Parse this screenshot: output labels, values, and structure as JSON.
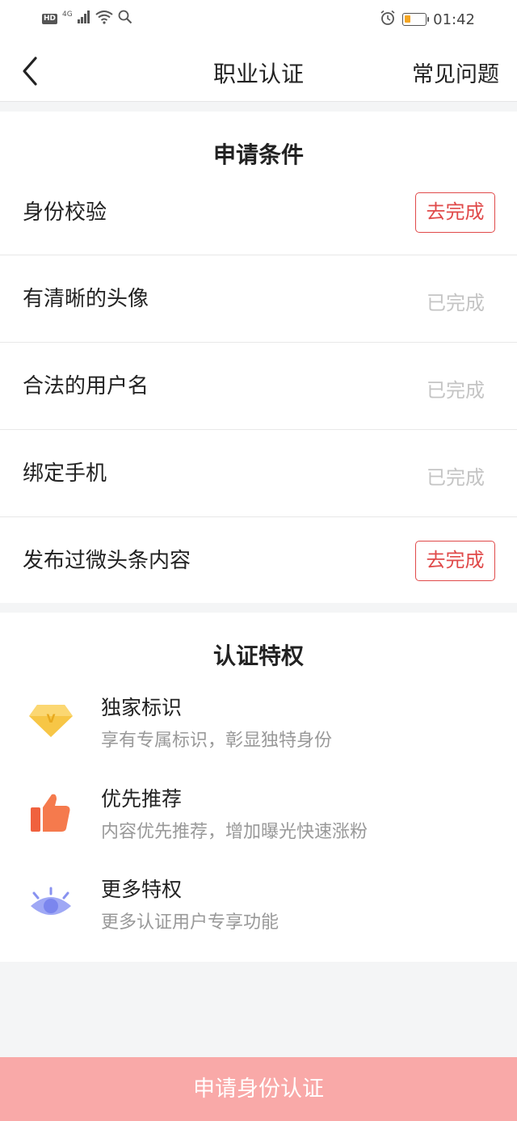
{
  "status_bar": {
    "hd": "HD",
    "network": "4G",
    "time": "01:42",
    "icons": [
      "signal-icon",
      "wifi-icon",
      "search-icon",
      "alarm-icon",
      "battery-icon"
    ]
  },
  "header": {
    "title": "职业认证",
    "faq_label": "常见问题",
    "back_icon": "chevron-left-icon"
  },
  "conditions": {
    "title": "申请条件",
    "items": [
      {
        "label": "身份校验",
        "status": "去完成",
        "done": false
      },
      {
        "label": "有清晰的头像",
        "status": "已完成",
        "done": true
      },
      {
        "label": "合法的用户名",
        "status": "已完成",
        "done": true
      },
      {
        "label": "绑定手机",
        "status": "已完成",
        "done": true
      },
      {
        "label": "发布过微头条内容",
        "status": "去完成",
        "done": false
      }
    ]
  },
  "privileges": {
    "title": "认证特权",
    "items": [
      {
        "name": "独家标识",
        "desc": "享有专属标识，彰显独特身份",
        "icon": "diamond-icon"
      },
      {
        "name": "优先推荐",
        "desc": "内容优先推荐，增加曝光快速涨粉",
        "icon": "thumbs-up-icon"
      },
      {
        "name": "更多特权",
        "desc": "更多认证用户专享功能",
        "icon": "eye-icon"
      }
    ]
  },
  "footer": {
    "apply_label": "申请身份认证"
  },
  "colors": {
    "accent_red": "#e04a4a",
    "done_gray": "#c4c4c4",
    "apply_button": "#f9a9a8"
  }
}
